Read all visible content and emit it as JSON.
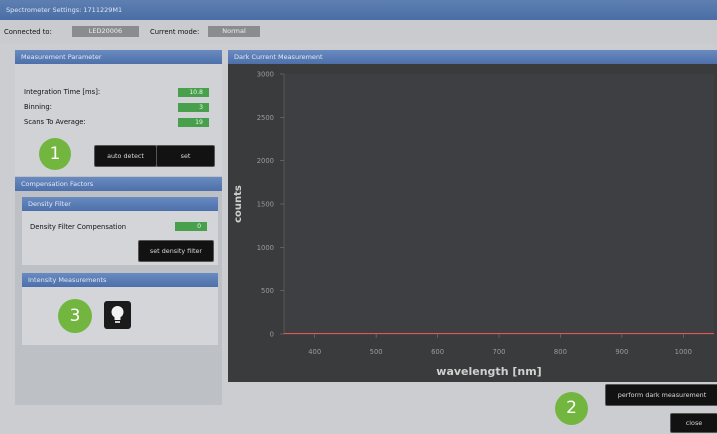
{
  "window": {
    "title": "Spectrometer Settings: 1711229M1"
  },
  "connection": {
    "connected_label": "Connected to:",
    "connected_value": "LED20006",
    "mode_label": "Current mode:",
    "mode_value": "Normal"
  },
  "measurement": {
    "header": "Measurement Parameter",
    "rows": [
      {
        "label": "Integration Time [ms]:",
        "value": "10.8"
      },
      {
        "label": "Binning:",
        "value": "3"
      },
      {
        "label": "Scans To Average:",
        "value": "19"
      }
    ],
    "auto_detect": "auto detect",
    "set": "set"
  },
  "compensation": {
    "header": "Compensation Factors",
    "density_header": "Density Filter",
    "density_label": "Density Filter Compensation",
    "density_value": "0",
    "set_density": "set density filter",
    "intensity_header": "Intensity Measurements"
  },
  "badges": {
    "b1": "1",
    "b2": "2",
    "b3": "3"
  },
  "chart_panel": {
    "header": "Dark Current Measurement"
  },
  "chart_data": {
    "type": "line",
    "xlabel": "wavelength [nm]",
    "ylabel": "counts",
    "xlim": [
      350,
      1050
    ],
    "ylim": [
      0,
      3000
    ],
    "xticks": [
      400,
      500,
      600,
      700,
      800,
      900,
      1000
    ],
    "yticks": [
      0,
      500,
      1000,
      1500,
      2000,
      2500,
      3000
    ],
    "series": [
      {
        "color": "#e0584f",
        "x": [
          350,
          1050
        ],
        "y": [
          5,
          5
        ]
      }
    ]
  },
  "buttons": {
    "perform_dark": "perform dark measurement",
    "close": "close"
  },
  "colors": {
    "accent": "#4d70ab",
    "badge": "#72b640",
    "value_green": "#48a04d"
  }
}
